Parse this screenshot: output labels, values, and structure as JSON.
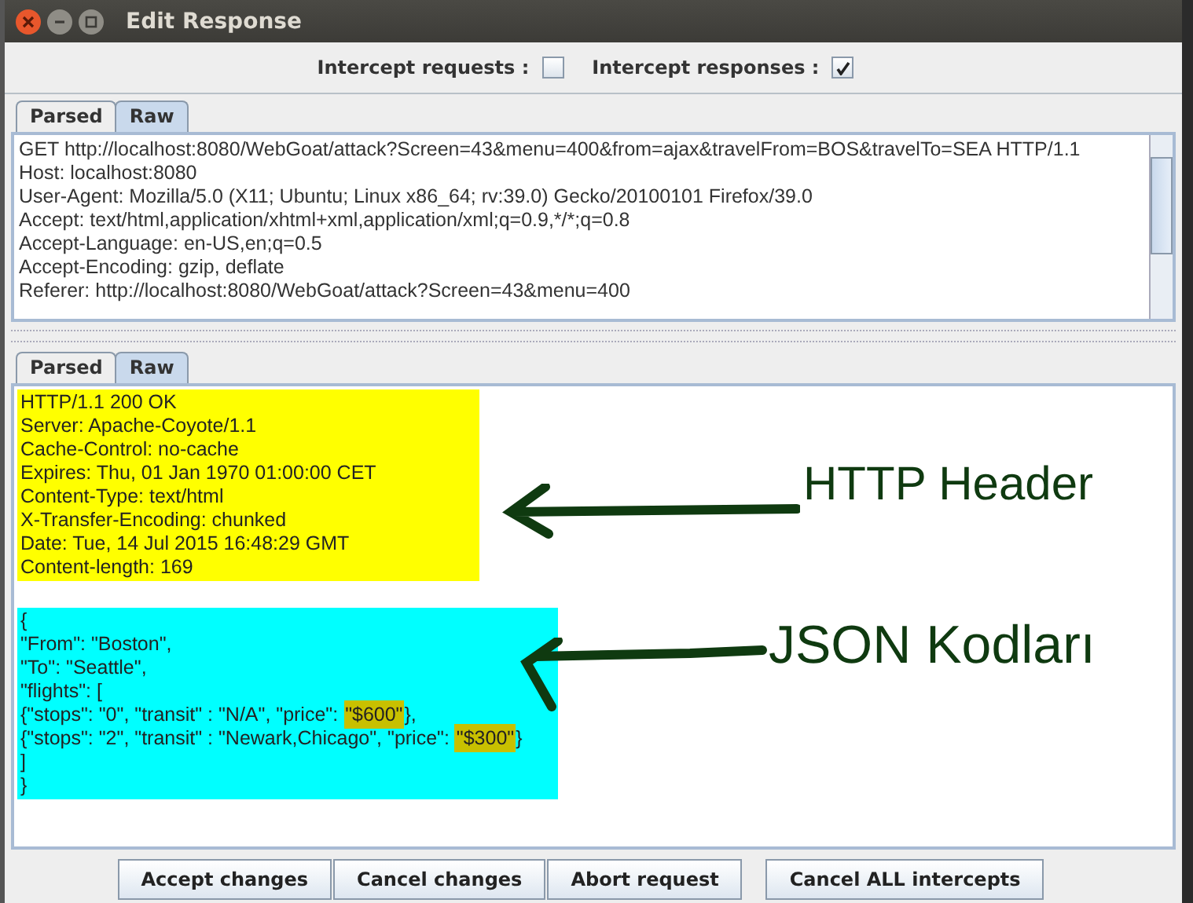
{
  "window": {
    "title": "Edit Response"
  },
  "options": [
    {
      "label": "Intercept requests :",
      "checked": false
    },
    {
      "label": "Intercept responses :",
      "checked": true
    }
  ],
  "request": {
    "tabs": [
      {
        "label": "Parsed",
        "selected": false
      },
      {
        "label": "Raw",
        "selected": true
      }
    ],
    "lines": [
      "GET http://localhost:8080/WebGoat/attack?Screen=43&menu=400&from=ajax&travelFrom=BOS&travelTo=SEA HTTP/1.1",
      "Host: localhost:8080",
      "User-Agent: Mozilla/5.0 (X11; Ubuntu; Linux x86_64; rv:39.0) Gecko/20100101 Firefox/39.0",
      "Accept: text/html,application/xhtml+xml,application/xml;q=0.9,*/*;q=0.8",
      "Accept-Language: en-US,en;q=0.5",
      "Accept-Encoding: gzip, deflate",
      "Referer: http://localhost:8080/WebGoat/attack?Screen=43&menu=400"
    ]
  },
  "response": {
    "tabs": [
      {
        "label": "Parsed",
        "selected": false
      },
      {
        "label": "Raw",
        "selected": true
      }
    ],
    "header_lines": [
      "HTTP/1.1 200 OK",
      "Server: Apache-Coyote/1.1",
      "Cache-Control: no-cache",
      "Expires: Thu, 01 Jan 1970 01:00:00 CET",
      "Content-Type: text/html",
      "X-Transfer-Encoding: chunked",
      "Date: Tue, 14 Jul 2015 16:48:29 GMT",
      "Content-length: 169"
    ],
    "body_lines": [
      [
        {
          "text": "{",
          "marked": false
        }
      ],
      [
        {
          "text": "\"From\": \"Boston\",",
          "marked": false
        }
      ],
      [
        {
          "text": "\"To\": \"Seattle\",",
          "marked": false
        }
      ],
      [
        {
          "text": "\"flights\": [",
          "marked": false
        }
      ],
      [
        {
          "text": "{\"stops\": \"0\", \"transit\" : \"N/A\", \"price\": ",
          "marked": false
        },
        {
          "text": "\"$600\"",
          "marked": true
        },
        {
          "text": "},",
          "marked": false
        }
      ],
      [
        {
          "text": "{\"stops\": \"2\", \"transit\" : \"Newark,Chicago\", \"price\": ",
          "marked": false
        },
        {
          "text": "\"$300\"",
          "marked": true
        },
        {
          "text": "}",
          "marked": false
        }
      ],
      [
        {
          "text": "]",
          "marked": false
        }
      ],
      [
        {
          "text": "}",
          "marked": false
        }
      ]
    ],
    "annotations": [
      "HTTP Header",
      "JSON Kodları"
    ]
  },
  "buttons": [
    "Accept changes",
    "Cancel changes",
    "Abort request",
    "Cancel ALL intercepts"
  ]
}
